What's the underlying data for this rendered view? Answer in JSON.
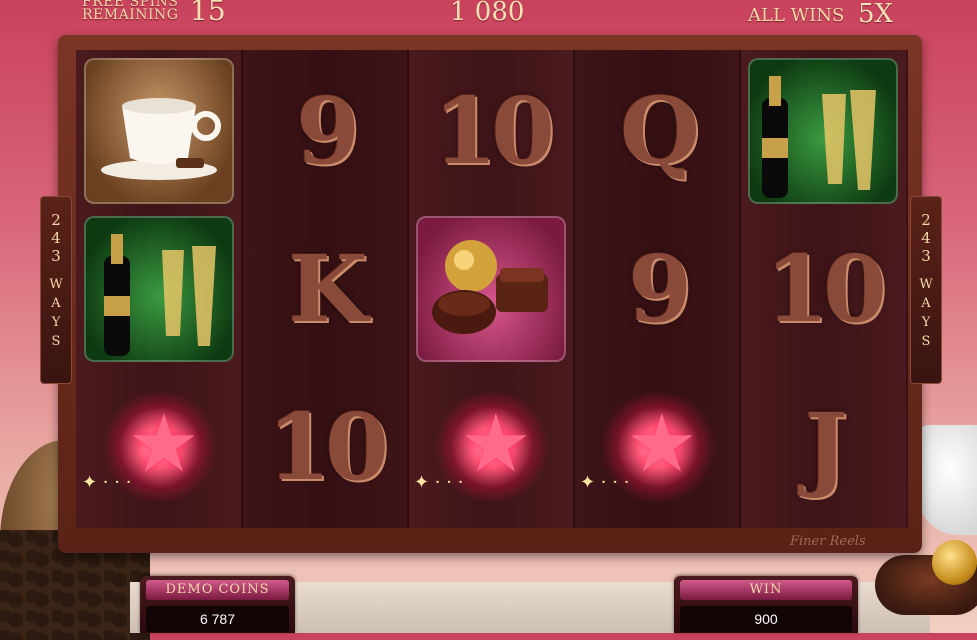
{
  "header": {
    "free_spins_label_line1": "FREE SPINS",
    "free_spins_label_line2": "REMAINING",
    "free_spins_remaining": "15",
    "total_win": "1 080",
    "multiplier_label": "ALL WINS",
    "multiplier_value": "5X"
  },
  "ways": {
    "number": [
      "2",
      "4",
      "3"
    ],
    "word": [
      "W",
      "A",
      "Y",
      "S"
    ]
  },
  "reels": [
    {
      "symbols": [
        "coffee-cup",
        "champagne",
        "star-wild"
      ]
    },
    {
      "symbols": [
        "9",
        "K",
        "10"
      ]
    },
    {
      "symbols": [
        "10",
        "chocolates",
        "star-wild"
      ]
    },
    {
      "symbols": [
        "Q",
        "9",
        "star-wild"
      ]
    },
    {
      "symbols": [
        "champagne",
        "10",
        "J"
      ]
    }
  ],
  "labels": {
    "r1c0": "9",
    "r1c1": "K",
    "r1c2": "10",
    "r2c0": "10",
    "r3c0": "Q",
    "r3c1": "9",
    "r4c1": "10",
    "r4c2": "J"
  },
  "brand": "Finer Reels",
  "footer": {
    "coins_label": "DEMO COINS",
    "coins_value": "6 787",
    "win_label": "WIN",
    "win_value": "900"
  },
  "colors": {
    "accent": "#f3d9a9",
    "frame": "#5a2216",
    "panel_label": "#d25a8a"
  }
}
